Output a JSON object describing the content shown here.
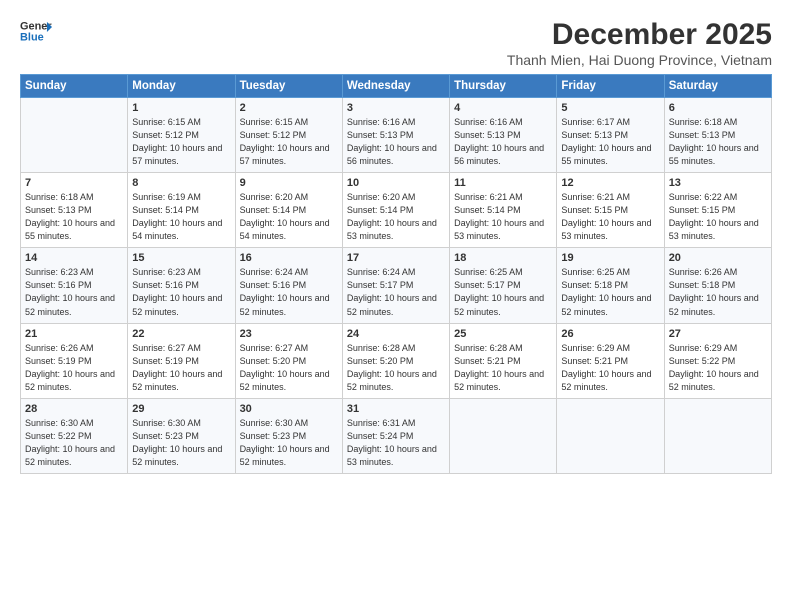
{
  "logo": {
    "line1": "General",
    "line2": "Blue"
  },
  "title": "December 2025",
  "subtitle": "Thanh Mien, Hai Duong Province, Vietnam",
  "header_days": [
    "Sunday",
    "Monday",
    "Tuesday",
    "Wednesday",
    "Thursday",
    "Friday",
    "Saturday"
  ],
  "weeks": [
    [
      {
        "day": "",
        "sunrise": "",
        "sunset": "",
        "daylight": ""
      },
      {
        "day": "1",
        "sunrise": "Sunrise: 6:15 AM",
        "sunset": "Sunset: 5:12 PM",
        "daylight": "Daylight: 10 hours and 57 minutes."
      },
      {
        "day": "2",
        "sunrise": "Sunrise: 6:15 AM",
        "sunset": "Sunset: 5:12 PM",
        "daylight": "Daylight: 10 hours and 57 minutes."
      },
      {
        "day": "3",
        "sunrise": "Sunrise: 6:16 AM",
        "sunset": "Sunset: 5:13 PM",
        "daylight": "Daylight: 10 hours and 56 minutes."
      },
      {
        "day": "4",
        "sunrise": "Sunrise: 6:16 AM",
        "sunset": "Sunset: 5:13 PM",
        "daylight": "Daylight: 10 hours and 56 minutes."
      },
      {
        "day": "5",
        "sunrise": "Sunrise: 6:17 AM",
        "sunset": "Sunset: 5:13 PM",
        "daylight": "Daylight: 10 hours and 55 minutes."
      },
      {
        "day": "6",
        "sunrise": "Sunrise: 6:18 AM",
        "sunset": "Sunset: 5:13 PM",
        "daylight": "Daylight: 10 hours and 55 minutes."
      }
    ],
    [
      {
        "day": "7",
        "sunrise": "Sunrise: 6:18 AM",
        "sunset": "Sunset: 5:13 PM",
        "daylight": "Daylight: 10 hours and 55 minutes."
      },
      {
        "day": "8",
        "sunrise": "Sunrise: 6:19 AM",
        "sunset": "Sunset: 5:14 PM",
        "daylight": "Daylight: 10 hours and 54 minutes."
      },
      {
        "day": "9",
        "sunrise": "Sunrise: 6:20 AM",
        "sunset": "Sunset: 5:14 PM",
        "daylight": "Daylight: 10 hours and 54 minutes."
      },
      {
        "day": "10",
        "sunrise": "Sunrise: 6:20 AM",
        "sunset": "Sunset: 5:14 PM",
        "daylight": "Daylight: 10 hours and 53 minutes."
      },
      {
        "day": "11",
        "sunrise": "Sunrise: 6:21 AM",
        "sunset": "Sunset: 5:14 PM",
        "daylight": "Daylight: 10 hours and 53 minutes."
      },
      {
        "day": "12",
        "sunrise": "Sunrise: 6:21 AM",
        "sunset": "Sunset: 5:15 PM",
        "daylight": "Daylight: 10 hours and 53 minutes."
      },
      {
        "day": "13",
        "sunrise": "Sunrise: 6:22 AM",
        "sunset": "Sunset: 5:15 PM",
        "daylight": "Daylight: 10 hours and 53 minutes."
      }
    ],
    [
      {
        "day": "14",
        "sunrise": "Sunrise: 6:23 AM",
        "sunset": "Sunset: 5:16 PM",
        "daylight": "Daylight: 10 hours and 52 minutes."
      },
      {
        "day": "15",
        "sunrise": "Sunrise: 6:23 AM",
        "sunset": "Sunset: 5:16 PM",
        "daylight": "Daylight: 10 hours and 52 minutes."
      },
      {
        "day": "16",
        "sunrise": "Sunrise: 6:24 AM",
        "sunset": "Sunset: 5:16 PM",
        "daylight": "Daylight: 10 hours and 52 minutes."
      },
      {
        "day": "17",
        "sunrise": "Sunrise: 6:24 AM",
        "sunset": "Sunset: 5:17 PM",
        "daylight": "Daylight: 10 hours and 52 minutes."
      },
      {
        "day": "18",
        "sunrise": "Sunrise: 6:25 AM",
        "sunset": "Sunset: 5:17 PM",
        "daylight": "Daylight: 10 hours and 52 minutes."
      },
      {
        "day": "19",
        "sunrise": "Sunrise: 6:25 AM",
        "sunset": "Sunset: 5:18 PM",
        "daylight": "Daylight: 10 hours and 52 minutes."
      },
      {
        "day": "20",
        "sunrise": "Sunrise: 6:26 AM",
        "sunset": "Sunset: 5:18 PM",
        "daylight": "Daylight: 10 hours and 52 minutes."
      }
    ],
    [
      {
        "day": "21",
        "sunrise": "Sunrise: 6:26 AM",
        "sunset": "Sunset: 5:19 PM",
        "daylight": "Daylight: 10 hours and 52 minutes."
      },
      {
        "day": "22",
        "sunrise": "Sunrise: 6:27 AM",
        "sunset": "Sunset: 5:19 PM",
        "daylight": "Daylight: 10 hours and 52 minutes."
      },
      {
        "day": "23",
        "sunrise": "Sunrise: 6:27 AM",
        "sunset": "Sunset: 5:20 PM",
        "daylight": "Daylight: 10 hours and 52 minutes."
      },
      {
        "day": "24",
        "sunrise": "Sunrise: 6:28 AM",
        "sunset": "Sunset: 5:20 PM",
        "daylight": "Daylight: 10 hours and 52 minutes."
      },
      {
        "day": "25",
        "sunrise": "Sunrise: 6:28 AM",
        "sunset": "Sunset: 5:21 PM",
        "daylight": "Daylight: 10 hours and 52 minutes."
      },
      {
        "day": "26",
        "sunrise": "Sunrise: 6:29 AM",
        "sunset": "Sunset: 5:21 PM",
        "daylight": "Daylight: 10 hours and 52 minutes."
      },
      {
        "day": "27",
        "sunrise": "Sunrise: 6:29 AM",
        "sunset": "Sunset: 5:22 PM",
        "daylight": "Daylight: 10 hours and 52 minutes."
      }
    ],
    [
      {
        "day": "28",
        "sunrise": "Sunrise: 6:30 AM",
        "sunset": "Sunset: 5:22 PM",
        "daylight": "Daylight: 10 hours and 52 minutes."
      },
      {
        "day": "29",
        "sunrise": "Sunrise: 6:30 AM",
        "sunset": "Sunset: 5:23 PM",
        "daylight": "Daylight: 10 hours and 52 minutes."
      },
      {
        "day": "30",
        "sunrise": "Sunrise: 6:30 AM",
        "sunset": "Sunset: 5:23 PM",
        "daylight": "Daylight: 10 hours and 52 minutes."
      },
      {
        "day": "31",
        "sunrise": "Sunrise: 6:31 AM",
        "sunset": "Sunset: 5:24 PM",
        "daylight": "Daylight: 10 hours and 53 minutes."
      },
      {
        "day": "",
        "sunrise": "",
        "sunset": "",
        "daylight": ""
      },
      {
        "day": "",
        "sunrise": "",
        "sunset": "",
        "daylight": ""
      },
      {
        "day": "",
        "sunrise": "",
        "sunset": "",
        "daylight": ""
      }
    ]
  ]
}
